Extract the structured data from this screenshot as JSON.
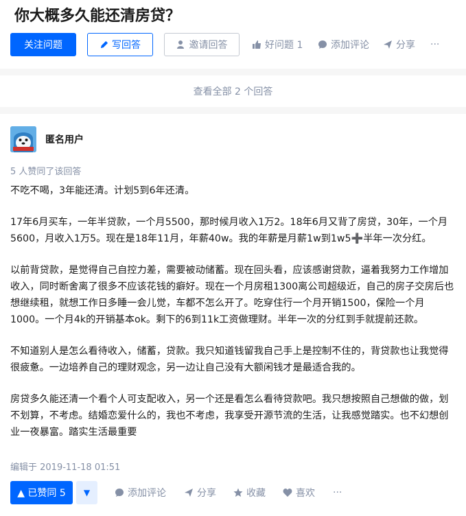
{
  "question": {
    "title": "你大概多久能还清房贷？",
    "follow_label": "关注问题",
    "write_label": "写回答",
    "invite_label": "邀请回答",
    "good_question_label": "好问题 1",
    "comment_label": "添加评论",
    "share_label": "分享",
    "more_label": "···"
  },
  "view_all": "查看全部 2 个回答",
  "answer": {
    "author": "匿名用户",
    "upvote_text": "5 人赞同了该回答",
    "paragraphs": [
      "不吃不喝，3年能还清。计划5到6年还清。",
      "17年6月买车，一年半贷款，一个月5500，那时候月收入1万2。18年6月又背了房贷，30年，一个月5600，月收入1万5。现在是18年11月，年薪40w。我的年薪是月薪1w到1w5➕半年一次分红。",
      "以前背贷款，是觉得自己自控力差，需要被动储蓄。现在回头看，应该感谢贷款，逼着我努力工作增加收入，同时断舍离了很多不应该花钱的癖好。现在一个月房租1300离公司超级近，自己的房子交房后也想继续租，就想工作日多睡一会儿觉，车都不怎么开了。吃穿住行一个月开销1500，保险一个月1000。一个月4k的开销基本ok。剩下的6到11k工资做理财。半年一次的分红到手就提前还款。",
      "不知道别人是怎么看待收入，储蓄，贷款。我只知道钱留我自己手上是控制不住的，背贷款也让我觉得很疲惫。一边培养自己的理财观念，另一边让自己没有大额闲钱才是最适合我的。",
      "房贷多久能还清一个看个人可支配收入，另一个还是看怎么看待贷款吧。我只想按照自己想做的做，划不划算，不考虑。结婚恋爱什么的，我也不考虑，我享受开源节流的生活，让我感觉踏实。也不幻想创业一夜暴富。踏实生活最重要"
    ],
    "edited": "编辑于 2019-11-18 01:51",
    "vote_label": "▲ 已赞同 5",
    "vote_down": "▼",
    "comment_label": "添加评论",
    "share_label": "分享",
    "collect_label": "收藏",
    "like_label": "喜欢",
    "more_label": "···"
  }
}
